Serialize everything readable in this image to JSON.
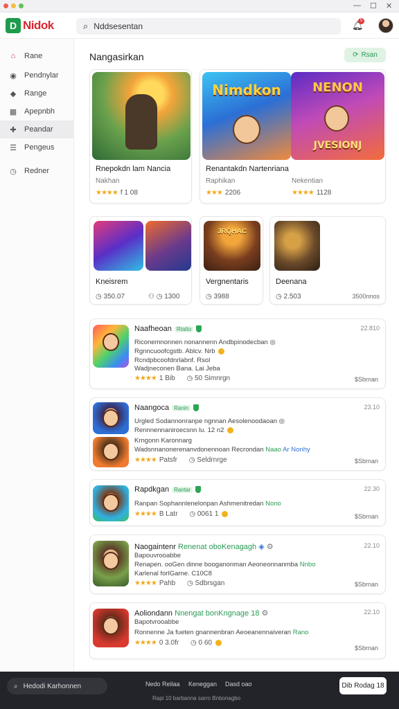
{
  "window": {
    "minimize": "—",
    "maximize": "☐",
    "close": "✕"
  },
  "header": {
    "logo_letter": "D",
    "logo_text": "Nidok",
    "search_placeholder": "Nddsesentan",
    "notification_count": "5"
  },
  "sidebar": {
    "items": [
      {
        "label": "Rane",
        "icon": "home-icon"
      },
      {
        "label": "Pendnylar",
        "icon": "compass-icon"
      },
      {
        "label": "Range",
        "icon": "tag-icon"
      },
      {
        "label": "Apepnbh",
        "icon": "grid-icon"
      },
      {
        "label": "Peandar",
        "icon": "gamepad-icon",
        "active": true
      },
      {
        "label": "Pengeus",
        "icon": "list-icon"
      },
      {
        "label": "Redner",
        "icon": "history-icon"
      }
    ]
  },
  "section": {
    "title": "Nangasirkan",
    "pill": "Rsan"
  },
  "featured": [
    {
      "title": "Rnepokdn lam Nancia",
      "sub": "Nakhan",
      "rating": "f 1 08",
      "art_label": ""
    },
    {
      "title": "Renantakdn Nartenriana",
      "sub": "Raphikan",
      "rating": "2206",
      "art_label": "Nimdkon"
    },
    {
      "title": "",
      "sub": "Nekentian",
      "rating": "1128",
      "art_label": "NENON"
    }
  ],
  "featured_art_sub": "JVESIONJ",
  "grid": [
    {
      "title": "Kneisrem",
      "meta1": "350.07",
      "meta2": "1300",
      "sq_label": ""
    },
    {
      "title": "Vergnentaris",
      "meta1": "3988",
      "sq_label": "JRQHAC"
    },
    {
      "title": "Deenana",
      "meta1": "2.503",
      "meta2": "3500nnos",
      "sq_label": ""
    }
  ],
  "list": [
    {
      "name": "Naafheoan",
      "tag": "Rtatto",
      "line1": "Riconemnonnen nonannenn Andbpinodecban",
      "line2": "Rgnncuoofcgstb. Ablcv. Nrb",
      "line3": "Rcndpbcoofdnrlabnf. Rsol",
      "line4": "Wadjneconen Bana. Lai Jeba",
      "rating": "1 Bib",
      "downloads": "50 Simnrgn",
      "date": "22.810",
      "price": "$Sbrnan"
    },
    {
      "name": "Naangoca",
      "tag": "Ranin",
      "line1": "Urgled Sodannonranpe ngnnan Aesolenoodaoan",
      "line2": "Rennnennaniroecsnn lu. 12 n2",
      "line3": "Krngonn Karonnarg",
      "line4": "Wadsnnanonerenanvdonennoan Recrondan",
      "line4_green": "Naao",
      "line4_blue": "Ar Nonhy",
      "rating": "Patsfr",
      "downloads": "Seldrnrge",
      "date": "23.10",
      "price": "$Sbrnan"
    },
    {
      "name": "Rapdkgan",
      "tag": "Rantar",
      "line1": "Ranpan Sophannlenelonpan Ashmenitredan",
      "line1_green": "Nono",
      "rating": "B Latr",
      "downloads": "0061 1",
      "date": "22.30",
      "price": "$Sbrnan"
    },
    {
      "name": "Naogaintenr",
      "green_title": "Renenat oboKenagagh",
      "line1": "Bapouvrooabbe",
      "line2": "Renapen. ooGen dinne booganonman Aeoneonnanmba",
      "line2_green": "Nnbo",
      "line3": "Karlenal forlGarne. C10C8",
      "rating": "Pahb",
      "downloads": "Sdbrsgan",
      "date": "22.10",
      "price": "$Sbrnan"
    },
    {
      "name": "Aoliondann",
      "green_title": "Nnengat bonKngnage 18",
      "line1": "Bapotvrooabbe",
      "line2": "Ronnenne Ja fueten gnannenbran Aeoeanennaiveran",
      "line2_green": "Rano",
      "rating": "0 3.0fr",
      "downloads": "0 60",
      "date": "22.10",
      "price": "$Sbrnan"
    }
  ],
  "footer": {
    "search": "Hedodi Karhonnen",
    "links": [
      "Nedo Reilaa",
      "Keneggan",
      "Dasd oao"
    ],
    "note": "Rapi 10 barbanna sarro Bnbonagbo",
    "button": "Dib Rodag 18"
  },
  "colors": {
    "brand": "#d8262f",
    "accent": "#2a9a55",
    "star": "#f2a81d"
  }
}
